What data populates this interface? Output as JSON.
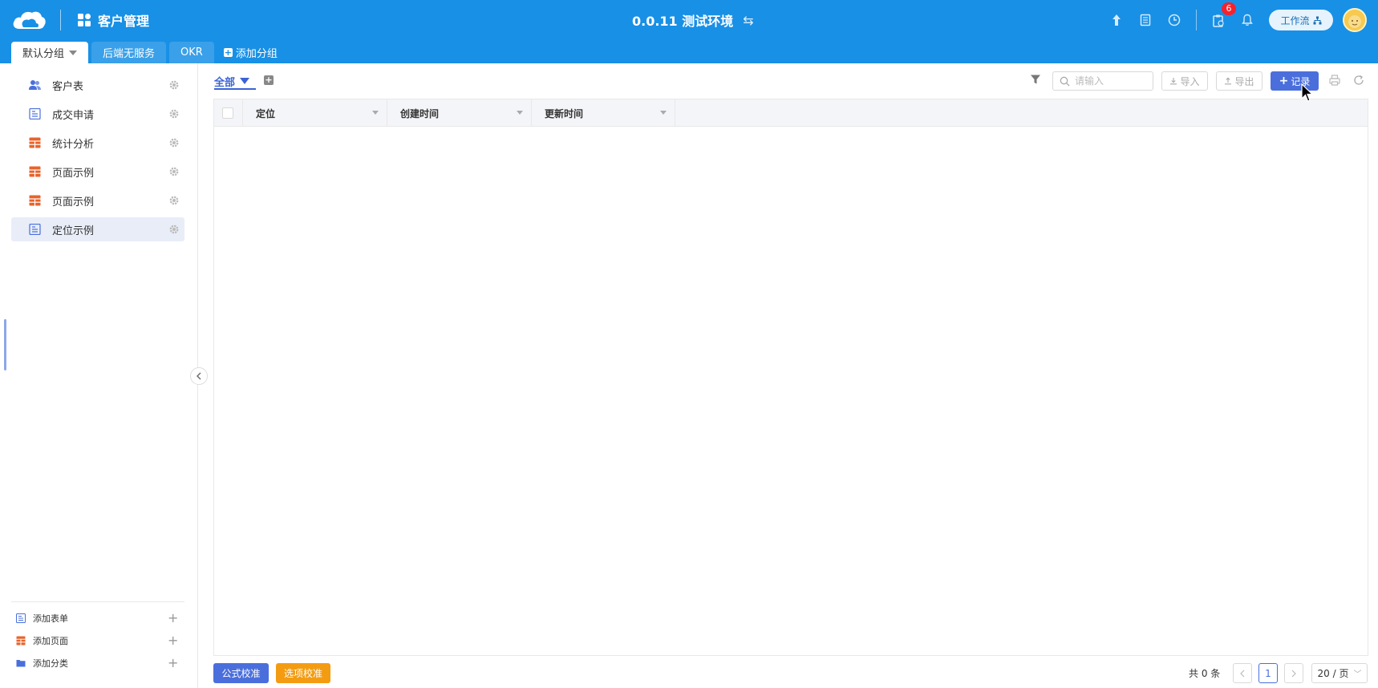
{
  "header": {
    "app_title": "客户管理",
    "env_title": "0.0.11 测试环境",
    "swap_symbol": "⇆",
    "notification_count": "6",
    "workflow_label": "工作流"
  },
  "group_tabs": [
    {
      "label": "默认分组",
      "active": true
    },
    {
      "label": "后端无服务",
      "active": false
    },
    {
      "label": "OKR",
      "active": false
    }
  ],
  "add_group_label": "添加分组",
  "sidebar": {
    "items": [
      {
        "label": "客户表",
        "icon": "users-icon"
      },
      {
        "label": "成交申请",
        "icon": "form-icon"
      },
      {
        "label": "统计分析",
        "icon": "table-icon"
      },
      {
        "label": "页面示例",
        "icon": "table-icon"
      },
      {
        "label": "页面示例",
        "icon": "table-icon"
      },
      {
        "label": "定位示例",
        "icon": "form-icon",
        "selected": true
      }
    ],
    "bottom": [
      {
        "label": "添加表单",
        "icon": "form-icon"
      },
      {
        "label": "添加页面",
        "icon": "table-icon"
      },
      {
        "label": "添加分类",
        "icon": "folder-icon"
      }
    ]
  },
  "view": {
    "tab_label": "全部"
  },
  "toolbar": {
    "search_placeholder": "请输入",
    "import_label": "导入",
    "export_label": "导出",
    "add_record_label": "记录"
  },
  "table": {
    "columns": [
      "定位",
      "创建时间",
      "更新时间"
    ]
  },
  "footer": {
    "formula_check_label": "公式校准",
    "option_check_label": "选项校准",
    "total_label": "共 0 条",
    "current_page": "1",
    "page_size_label": "20 / 页"
  },
  "colors": {
    "header_bg": "#1890e6",
    "primary": "#4a6fdc",
    "orange": "#f39c12",
    "icon_orange": "#e8632b",
    "icon_blue": "#4a6fdc"
  }
}
